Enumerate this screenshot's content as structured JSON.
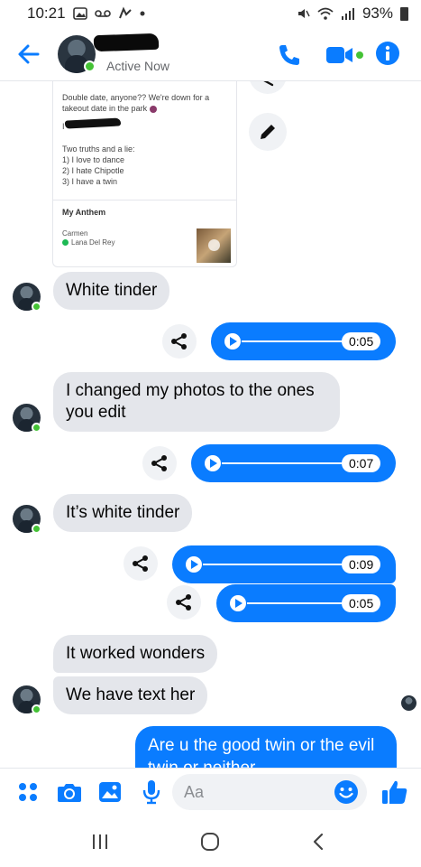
{
  "status_bar": {
    "time": "10:21",
    "battery": "93%",
    "left_icons": [
      "gallery-icon",
      "voicemail-icon",
      "messenger-icon",
      "dot-icon"
    ],
    "right_icons": [
      "mute-icon",
      "wifi-icon",
      "signal-icon",
      "battery-icon"
    ]
  },
  "header": {
    "contact_name": "",
    "status": "Active Now"
  },
  "profile_card": {
    "bio_line1": "Double date, anyone?? We're down for a",
    "bio_line2": "takeout date in the park",
    "bio_line3": "I",
    "list_title": "Two truths and a lie:",
    "list_items": [
      "1) I love to dance",
      "2) I hate Chipotle",
      "3) I have a twin"
    ],
    "anthem_title": "My Anthem",
    "song": "Carmen",
    "artist": "Lana Del Rey"
  },
  "messages": {
    "m1": "White tinder",
    "a1": "0:05",
    "m2": "I changed my photos to the ones you edit",
    "a2": "0:07",
    "m3": "It’s white tinder",
    "a3": "0:09",
    "a4": "0:05",
    "m4": "It worked wonders",
    "m5": "We have text her",
    "out1": "Are u the good twin or the evil twin or neither"
  },
  "composer": {
    "placeholder": "Aa"
  },
  "colors": {
    "accent": "#0a7cff",
    "incoming_bubble": "#e4e6eb",
    "online": "#44c235"
  }
}
